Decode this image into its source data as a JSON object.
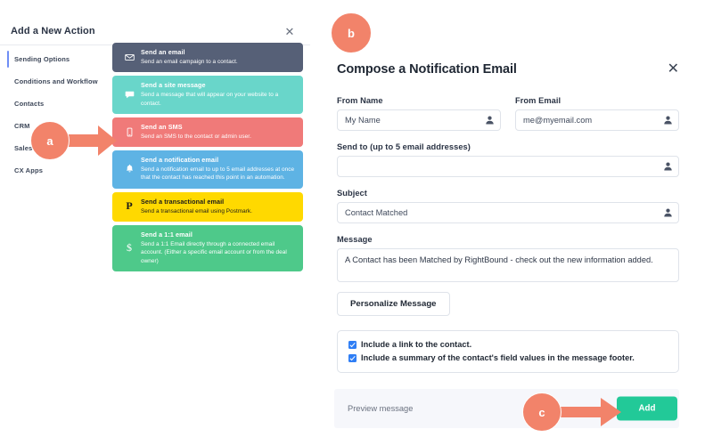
{
  "left_panel": {
    "title": "Add a New Action",
    "close_icon": "close-icon",
    "nav_items": [
      {
        "label": "Sending Options",
        "active": true
      },
      {
        "label": "Conditions and Workflow",
        "active": false
      },
      {
        "label": "Contacts",
        "active": false
      },
      {
        "label": "CRM",
        "active": false
      },
      {
        "label": "Sales",
        "active": false
      },
      {
        "label": "CX Apps",
        "active": false
      }
    ],
    "cards": [
      {
        "title": "Send an email",
        "desc": "Send an email campaign to a contact.",
        "icon": "envelope-icon",
        "color": "#566077",
        "cls": "c-email"
      },
      {
        "title": "Send a site message",
        "desc": "Send a message that will appear on your website to a contact.",
        "icon": "chat-bubble-icon",
        "color": "#69d6ca",
        "cls": "c-site"
      },
      {
        "title": "Send an SMS",
        "desc": "Send an SMS to the contact or admin user.",
        "icon": "mobile-phone-icon",
        "color": "#f07a79",
        "cls": "c-sms"
      },
      {
        "title": "Send a notification email",
        "desc": "Send a notification email to up to 5 email addresses at once that the contact has reached this point in an automation.",
        "icon": "bell-icon",
        "color": "#5eb3e4",
        "cls": "c-notify"
      },
      {
        "title": "Send a transactional email",
        "desc": "Send a transactional email using Postmark.",
        "icon": "postmark-p-icon",
        "color": "#ffd900",
        "cls": "c-trans"
      },
      {
        "title": "Send a 1:1 email",
        "desc": "Send a 1:1 Email directly through a connected email account. (Either a specific email account or from the deal owner)",
        "icon": "dollar-sign-icon",
        "color": "#4ec98a",
        "cls": "c-one"
      }
    ]
  },
  "right_panel": {
    "heading": "Compose a Notification Email",
    "close_icon": "close-icon",
    "fields": {
      "from_name": {
        "label": "From Name",
        "value": "My Name",
        "placeholder": ""
      },
      "from_email": {
        "label": "From Email",
        "value": "me@myemail.com",
        "placeholder": ""
      },
      "send_to": {
        "label": "Send to (up to 5 email addresses)",
        "value": "",
        "placeholder": ""
      },
      "subject": {
        "label": "Subject",
        "value": "Contact Matched",
        "placeholder": ""
      },
      "message": {
        "label": "Message",
        "value": "A Contact has been Matched by RightBound - check out the new information added."
      }
    },
    "personalize_button": "Personalize Message",
    "checkboxes": [
      {
        "label": "Include a link to the contact.",
        "checked": true
      },
      {
        "label": "Include a summary of the contact's field values in the message footer.",
        "checked": true
      }
    ],
    "footer": {
      "preview_link": "Preview message",
      "add_button": "Add",
      "add_button_color": "#22c998"
    }
  },
  "annotations": {
    "accent_color": "#f2836a",
    "badges": [
      {
        "id": "a",
        "label": "a"
      },
      {
        "id": "b",
        "label": "b"
      },
      {
        "id": "c",
        "label": "c"
      }
    ]
  }
}
